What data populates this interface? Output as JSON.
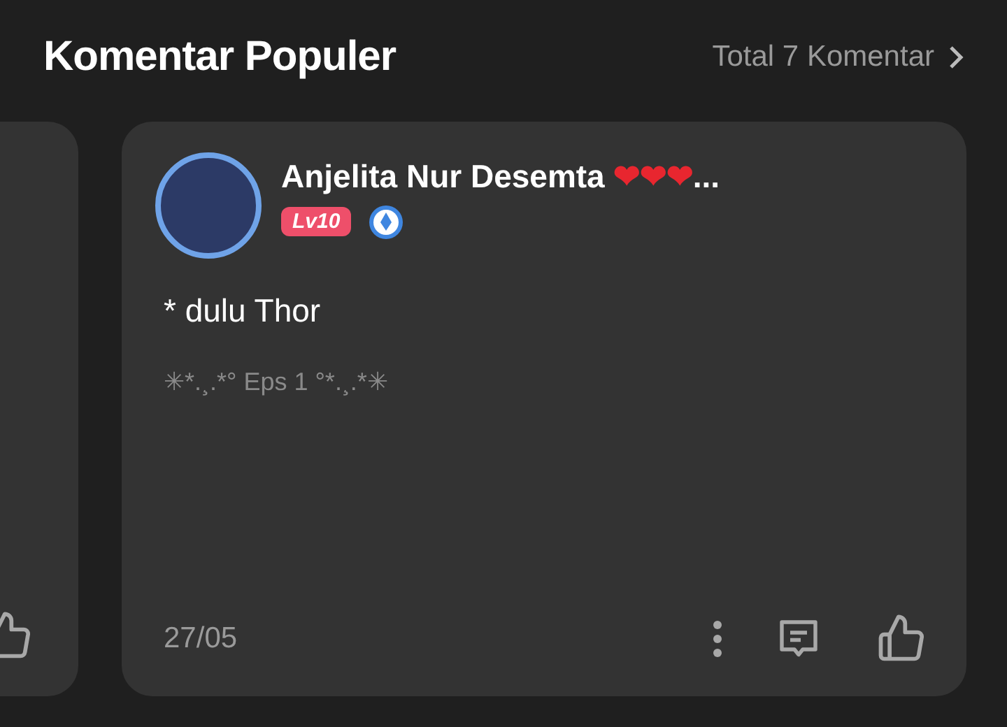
{
  "header": {
    "title": "Komentar Populer",
    "total_link": "Total 7 Komentar"
  },
  "comment": {
    "author": {
      "name": "Anjelita Nur Desemta",
      "emoji": "❤❤❤",
      "truncation": "...",
      "level_badge": "Lv10"
    },
    "text": "* dulu Thor",
    "episode": "✳*.¸.*° Eps 1 °*.¸.*✳",
    "date": "27/05"
  }
}
